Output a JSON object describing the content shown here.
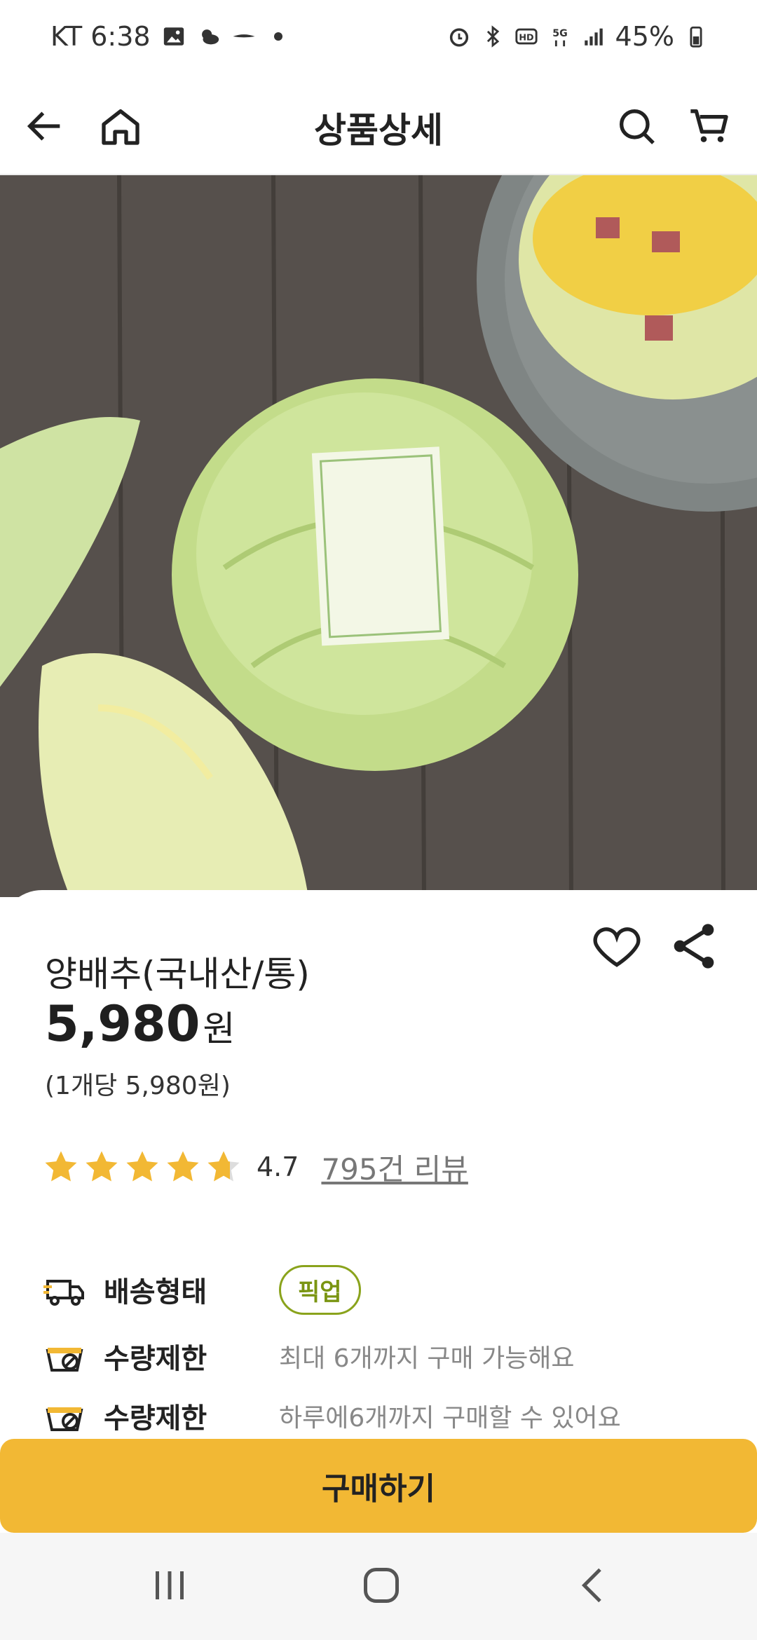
{
  "status_bar": {
    "carrier_time": "KT 6:38",
    "battery": "45%"
  },
  "app_bar": {
    "title": "상품상세",
    "icons": [
      "back-arrow-icon",
      "home-icon",
      "search-icon",
      "cart-icon"
    ]
  },
  "product": {
    "name": "양배추(국내산/통)",
    "price": "5,980",
    "currency": "원",
    "unit_price": "(1개당 5,980원)",
    "rating": {
      "score": "4.7",
      "stars_value": 4.7,
      "stars_max": 5,
      "reviews_label": "795건 리뷰"
    },
    "info_rows": [
      {
        "label": "배송형태",
        "value": "픽업",
        "icon": "delivery-truck-icon"
      },
      {
        "label": "수량제한",
        "value": "최대 6개까지 구매 가능해요",
        "icon": "basket-limit-icon"
      },
      {
        "label": "수량제한",
        "value": "하루에6개까지 구매할 수 있어요",
        "icon": "basket-limit-icon"
      }
    ]
  },
  "buy_button": {
    "label": "구매하기"
  },
  "colors": {
    "accent": "#f2b834",
    "pill_green": "#8aa31c",
    "star": "#f2b834"
  }
}
